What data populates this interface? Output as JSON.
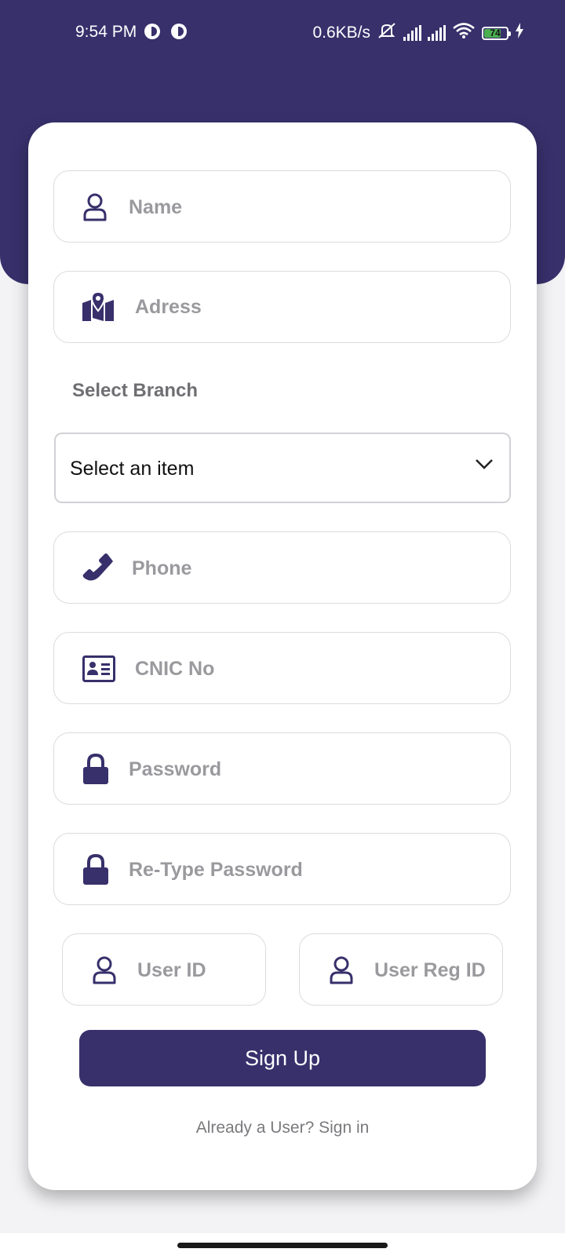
{
  "status_bar": {
    "time": "9:54 PM",
    "network_speed": "0.6KB/s",
    "battery_level": "74",
    "battery_fraction": 0.74,
    "icons": [
      "status-notification-icon",
      "status-notification-icon",
      "mute-icon",
      "signal-icon",
      "signal-icon",
      "wifi-icon",
      "battery-icon",
      "charging-icon"
    ]
  },
  "form": {
    "name_placeholder": "Name",
    "address_placeholder": "Adress",
    "branch_label": "Select Branch",
    "branch_select_value": "Select an item",
    "phone_placeholder": "Phone",
    "cnic_placeholder": "CNIC No",
    "password_placeholder": "Password",
    "retype_password_placeholder": "Re-Type Password",
    "user_id_placeholder": "User ID",
    "user_reg_id_placeholder": "User Reg ID",
    "signup_label": "Sign Up",
    "signin_link": "Already a User? Sign in"
  },
  "colors": {
    "primary": "#37306b",
    "background": "#f3f3f5",
    "card": "#ffffff",
    "placeholder_text": "#9a9a9e"
  }
}
